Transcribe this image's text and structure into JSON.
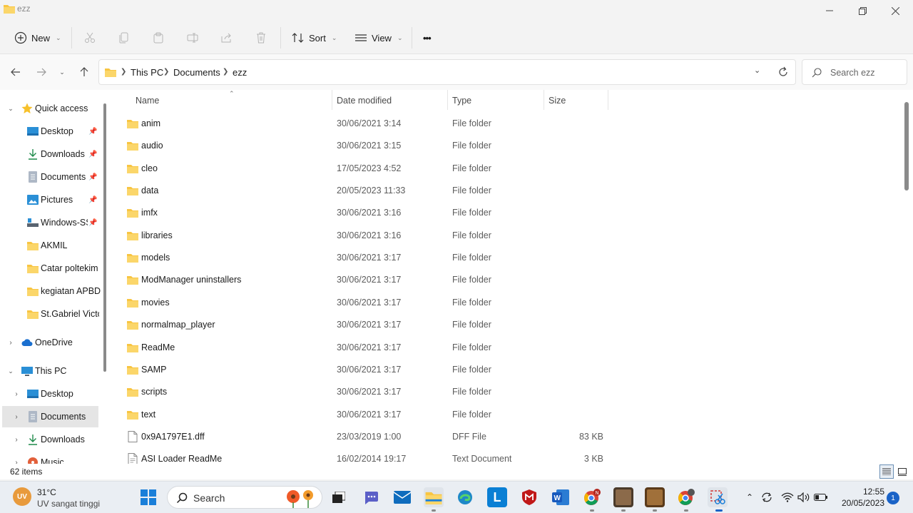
{
  "window": {
    "title": "ezz"
  },
  "toolbar": {
    "new_label": "New",
    "sort_label": "Sort",
    "view_label": "View",
    "more_label": "•••"
  },
  "address": {
    "crumbs": [
      "This PC",
      "Documents",
      "ezz"
    ],
    "search_placeholder": "Search ezz"
  },
  "sidebar": {
    "items": [
      {
        "label": "Quick access",
        "icon": "star-icon",
        "pinned": false
      },
      {
        "label": "Desktop",
        "icon": "desktop-icon",
        "pinned": true
      },
      {
        "label": "Downloads",
        "icon": "download-icon",
        "pinned": true
      },
      {
        "label": "Documents",
        "icon": "documents-icon",
        "pinned": true
      },
      {
        "label": "Pictures",
        "icon": "pictures-icon",
        "pinned": true
      },
      {
        "label": "Windows-SS",
        "icon": "drive-icon",
        "pinned": true
      },
      {
        "label": "AKMIL",
        "icon": "folder-icon",
        "pinned": false
      },
      {
        "label": "Catar poltekim",
        "icon": "folder-icon",
        "pinned": false
      },
      {
        "label": "kegiatan APBD",
        "icon": "folder-icon",
        "pinned": false
      },
      {
        "label": "St.Gabriel Victor",
        "icon": "folder-icon",
        "pinned": false
      },
      {
        "label": "OneDrive",
        "icon": "cloud-icon",
        "pinned": false
      },
      {
        "label": "This PC",
        "icon": "computer-icon",
        "pinned": false
      },
      {
        "label": "Desktop",
        "icon": "desktop-icon",
        "pinned": false
      },
      {
        "label": "Documents",
        "icon": "documents-icon",
        "pinned": false
      },
      {
        "label": "Downloads",
        "icon": "download-icon",
        "pinned": false
      },
      {
        "label": "Music",
        "icon": "music-icon",
        "pinned": false
      }
    ]
  },
  "columns": {
    "name": "Name",
    "date": "Date modified",
    "type": "Type",
    "size": "Size"
  },
  "files": [
    {
      "name": "anim",
      "date": "30/06/2021 3:14",
      "type": "File folder",
      "size": "",
      "icon": "folder-icon"
    },
    {
      "name": "audio",
      "date": "30/06/2021 3:15",
      "type": "File folder",
      "size": "",
      "icon": "folder-icon"
    },
    {
      "name": "cleo",
      "date": "17/05/2023 4:52",
      "type": "File folder",
      "size": "",
      "icon": "folder-icon"
    },
    {
      "name": "data",
      "date": "20/05/2023 11:33",
      "type": "File folder",
      "size": "",
      "icon": "folder-icon"
    },
    {
      "name": "imfx",
      "date": "30/06/2021 3:16",
      "type": "File folder",
      "size": "",
      "icon": "folder-icon"
    },
    {
      "name": "libraries",
      "date": "30/06/2021 3:16",
      "type": "File folder",
      "size": "",
      "icon": "folder-icon"
    },
    {
      "name": "models",
      "date": "30/06/2021 3:17",
      "type": "File folder",
      "size": "",
      "icon": "folder-icon"
    },
    {
      "name": "ModManager uninstallers",
      "date": "30/06/2021 3:17",
      "type": "File folder",
      "size": "",
      "icon": "folder-icon"
    },
    {
      "name": "movies",
      "date": "30/06/2021 3:17",
      "type": "File folder",
      "size": "",
      "icon": "folder-icon"
    },
    {
      "name": "normalmap_player",
      "date": "30/06/2021 3:17",
      "type": "File folder",
      "size": "",
      "icon": "folder-icon"
    },
    {
      "name": "ReadMe",
      "date": "30/06/2021 3:17",
      "type": "File folder",
      "size": "",
      "icon": "folder-icon"
    },
    {
      "name": "SAMP",
      "date": "30/06/2021 3:17",
      "type": "File folder",
      "size": "",
      "icon": "folder-icon"
    },
    {
      "name": "scripts",
      "date": "30/06/2021 3:17",
      "type": "File folder",
      "size": "",
      "icon": "folder-icon"
    },
    {
      "name": "text",
      "date": "30/06/2021 3:17",
      "type": "File folder",
      "size": "",
      "icon": "folder-icon"
    },
    {
      "name": "0x9A1797E1.dff",
      "date": "23/03/2019 1:00",
      "type": "DFF File",
      "size": "83 KB",
      "icon": "file-icon"
    },
    {
      "name": "ASI Loader ReadMe",
      "date": "16/02/2014 19:17",
      "type": "Text Document",
      "size": "3 KB",
      "icon": "text-file-icon"
    }
  ],
  "status": {
    "item_count": "62 items"
  },
  "taskbar": {
    "weather_badge": "UV",
    "temperature": "31°C",
    "weather_desc": "UV sangat tinggi",
    "search_label": "Search",
    "time": "12:55",
    "date": "20/05/2023",
    "notification_count": "1"
  },
  "colors": {
    "folder": "#f8c542",
    "accent": "#1a63c7"
  }
}
